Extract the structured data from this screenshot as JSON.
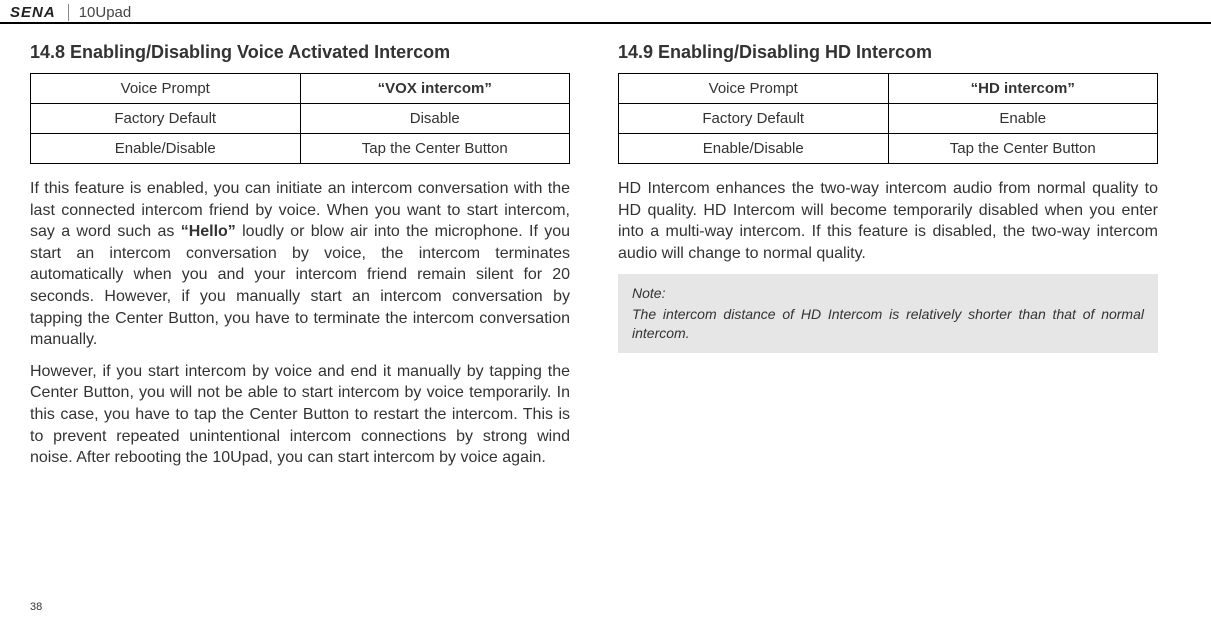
{
  "header": {
    "logo": "SENA",
    "product": "10Upad"
  },
  "left": {
    "heading": "14.8 Enabling/Disabling Voice Activated Intercom",
    "table": {
      "r1c1": "Voice Prompt",
      "r1c2": "“VOX intercom”",
      "r2c1": "Factory Default",
      "r2c2": "Disable",
      "r3c1": "Enable/Disable",
      "r3c2": "Tap the Center Button"
    },
    "p1_a": "If this feature is enabled, you can initiate an intercom conversation with the last connected intercom friend by voice. When you want to start intercom, say a word such as ",
    "p1_hello": "“Hello”",
    "p1_b": " loudly or blow air into the microphone. If you start an intercom conversation by voice, the intercom terminates automatically when you and your intercom friend remain silent for 20 seconds. However, if you manually start an intercom conversation by tapping the Center Button, you have to terminate the intercom conversation manually.",
    "p2": "However, if you start intercom by voice and end it manually by tapping the Center Button, you will not be able to start intercom by voice temporarily. In this case, you have to tap the Center Button to restart the intercom. This is to prevent repeated unintentional intercom connections by strong wind noise. After rebooting the 10Upad, you can start intercom by voice again."
  },
  "right": {
    "heading": "14.9 Enabling/Disabling HD Intercom",
    "table": {
      "r1c1": "Voice Prompt",
      "r1c2": "“HD intercom”",
      "r2c1": "Factory Default",
      "r2c2": "Enable",
      "r3c1": "Enable/Disable",
      "r3c2": "Tap the Center Button"
    },
    "p1": "HD Intercom enhances the two-way intercom audio from normal quality to HD quality. HD Intercom will become temporarily disabled when you enter into a multi-way intercom. If this feature is disabled, the two-way intercom audio will change to normal quality.",
    "note_label": "Note:",
    "note_text": "The intercom distance of HD Intercom is relatively shorter than that of normal intercom."
  },
  "page_number": "38"
}
